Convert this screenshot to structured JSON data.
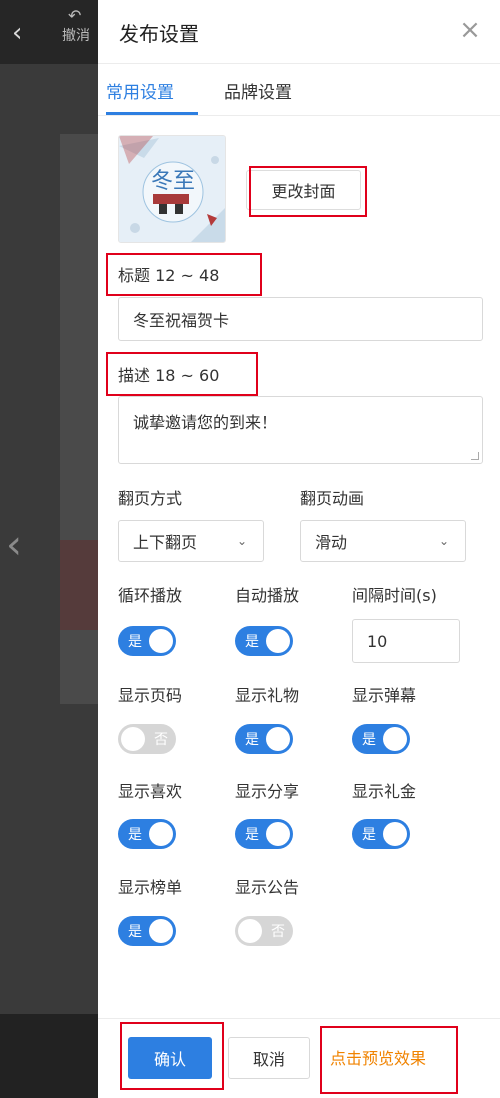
{
  "backdrop": {
    "undo_label": "撤消"
  },
  "drawer": {
    "title": "发布设置"
  },
  "tabs": [
    {
      "label": "常用设置",
      "active": true
    },
    {
      "label": "品牌设置",
      "active": false
    }
  ],
  "cover": {
    "change_label": "更改封面",
    "image_text": "冬至"
  },
  "title_field": {
    "label": "标题 12 ~ 48",
    "value": "冬至祝福贺卡"
  },
  "desc_field": {
    "label": "描述 18 ~ 60",
    "value": "诚挚邀请您的到来！"
  },
  "page_mode": {
    "label": "翻页方式",
    "value": "上下翻页"
  },
  "page_anim": {
    "label": "翻页动画",
    "value": "滑动"
  },
  "toggles": {
    "on_text": "是",
    "off_text": "否",
    "loop": {
      "label": "循环播放",
      "on": true
    },
    "autoplay": {
      "label": "自动播放",
      "on": true
    },
    "page_num": {
      "label": "显示页码",
      "on": false
    },
    "gift": {
      "label": "显示礼物",
      "on": true
    },
    "danmu": {
      "label": "显示弹幕",
      "on": true
    },
    "like": {
      "label": "显示喜欢",
      "on": true
    },
    "share": {
      "label": "显示分享",
      "on": true
    },
    "cash_gift": {
      "label": "显示礼金",
      "on": true
    },
    "ranking": {
      "label": "显示榜单",
      "on": true
    },
    "notice": {
      "label": "显示公告",
      "on": false
    }
  },
  "interval": {
    "label": "间隔时间(s)",
    "value": "10"
  },
  "footer": {
    "confirm_label": "确认",
    "cancel_label": "取消",
    "preview_label": "点击预览效果"
  },
  "colors": {
    "accent": "#2d7fe1",
    "highlight_box": "#e0001b",
    "preview_link": "#f08300"
  }
}
